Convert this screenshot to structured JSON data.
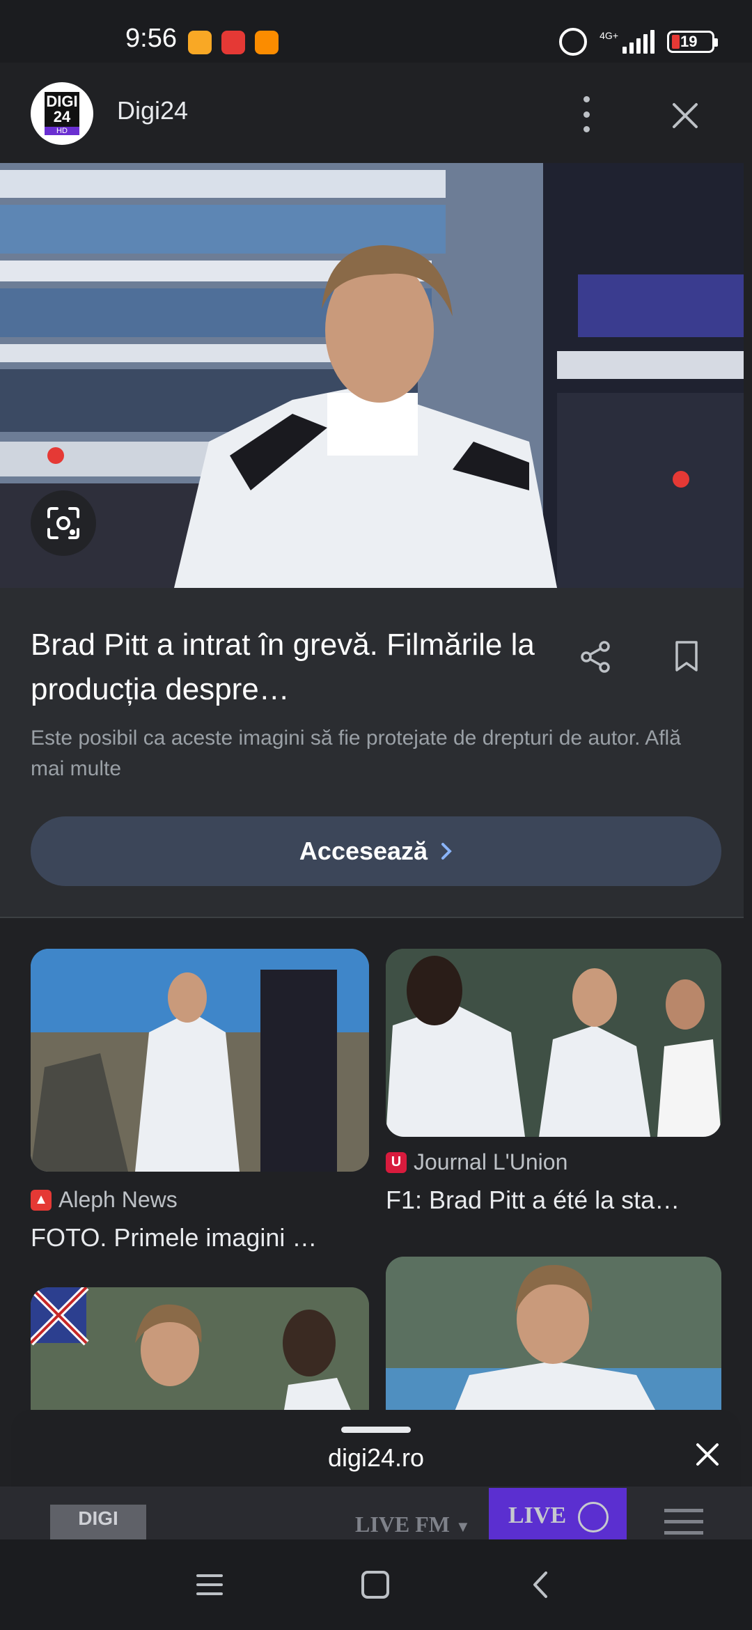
{
  "status_bar": {
    "time": "9:56",
    "network": "4G+",
    "battery": "19",
    "battery_level_pct": 19,
    "colors": {
      "battery_low": "#e53935"
    }
  },
  "header": {
    "logo_text": "DIGI 24",
    "logo_sub": "HD",
    "site_name": "Digi24"
  },
  "article": {
    "headline": "Brad Pitt a intrat în grevă. Filmările la producția despre…",
    "copyright_notice": "Este posibil ca aceste imagini să fie protejate de drepturi de autor. Află mai multe",
    "access_button": "Accesează"
  },
  "related": [
    {
      "source": "Aleph News",
      "source_icon": "aleph-icon",
      "source_color": "#e53935",
      "title": "FOTO. Primele imagini …"
    },
    {
      "source": "Journal L'Union",
      "source_icon": "union-icon",
      "source_color": "#d81b3d",
      "source_letter": "U",
      "title": "F1: Brad Pitt a été la sta…"
    },
    {
      "source": "",
      "title": ""
    },
    {
      "source": "",
      "title": ""
    }
  ],
  "bottom_sheet": {
    "url": "digi24.ro"
  },
  "web_peek": {
    "logo": "DIGI",
    "live_fm": "LIVE FM",
    "live": "LIVE"
  },
  "colors": {
    "background": "#202124",
    "accent_button": "#3c4659",
    "live_purple": "#5b2fd0"
  }
}
